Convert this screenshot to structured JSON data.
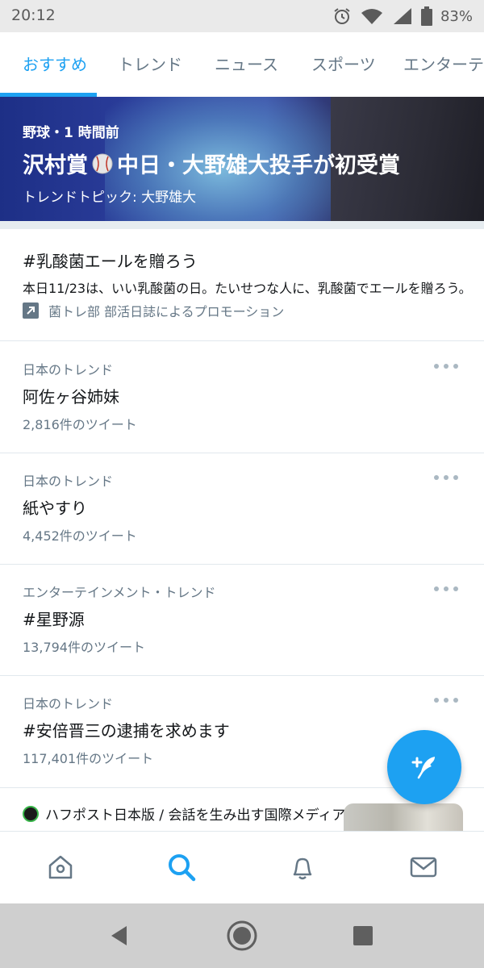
{
  "status_bar": {
    "time": "20:12",
    "battery": "83%",
    "icons": [
      "alarm-icon",
      "wifi-icon",
      "signal-icon",
      "battery-icon"
    ]
  },
  "tabs": [
    {
      "label": "おすすめ",
      "active": true
    },
    {
      "label": "トレンド",
      "active": false
    },
    {
      "label": "ニュース",
      "active": false
    },
    {
      "label": "スポーツ",
      "active": false
    },
    {
      "label": "エンターテイ",
      "active": false
    }
  ],
  "hero": {
    "category": "野球・1 時間前",
    "headline_before": "沢村賞",
    "headline_after": "中日・大野雄大投手が初受賞",
    "topic": "トレンドトピック: 大野雄大"
  },
  "promo": {
    "title": "#乳酸菌エールを贈ろう",
    "description": "本日11/23は、いい乳酸菌の日。たいせつな人に、乳酸菌でエールを贈ろう。",
    "promoted_by": "菌トレ部 部活日誌によるプロモーション"
  },
  "trends": [
    {
      "category": "日本のトレンド",
      "name": "阿佐ヶ谷姉妹",
      "count": "2,816件のツイート"
    },
    {
      "category": "日本のトレンド",
      "name": "紙やすり",
      "count": "4,452件のツイート"
    },
    {
      "category": "エンターテインメント・トレンド",
      "name": "#星野源",
      "count": "13,794件のツイート"
    },
    {
      "category": "日本のトレンド",
      "name": "#安倍晋三の逮捕を求めます",
      "count": "117,401件のツイート"
    }
  ],
  "news": {
    "source": "ハフポスト日本版 / 会話を生み出す国際メディア"
  },
  "bottom_nav": [
    "home-icon",
    "search-icon",
    "notifications-icon",
    "messages-icon"
  ],
  "colors": {
    "accent": "#1da1f2",
    "secondary_text": "#657786",
    "primary_text": "#14171a",
    "divider": "#e1e8ed"
  }
}
